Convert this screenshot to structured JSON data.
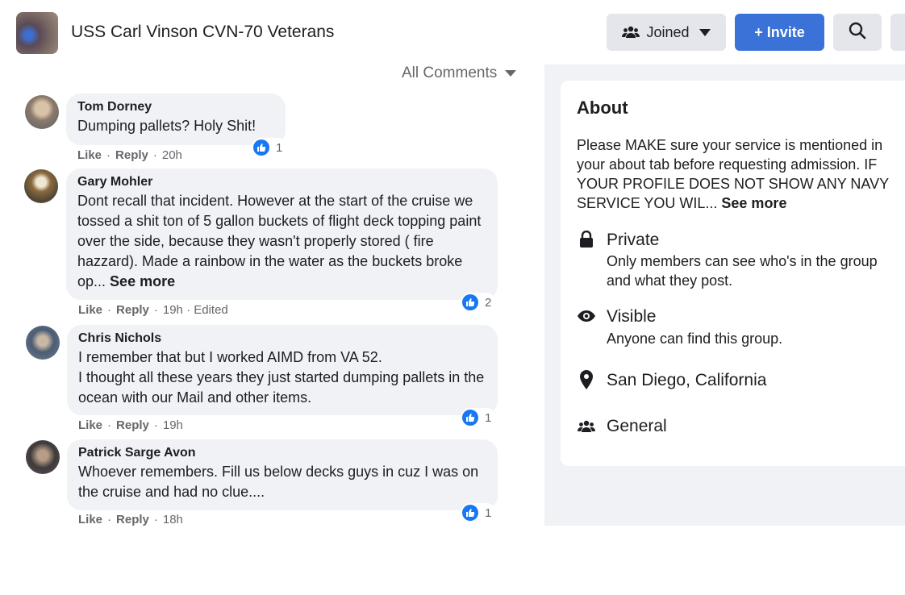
{
  "header": {
    "group_name": "USS Carl Vinson CVN-70 Veterans",
    "joined_label": "Joined",
    "invite_label": "+ Invite",
    "icons": [
      "group-avatar",
      "people-icon",
      "chevron-down-icon",
      "search-icon",
      "more-icon"
    ]
  },
  "comments_sort": "All Comments",
  "comments": [
    {
      "author": "Tom Dorney",
      "text": "Dumping pallets? Holy Shit!",
      "like": "Like",
      "reply": "Reply",
      "meta": "20h",
      "reactions": "1"
    },
    {
      "author": "Gary Mohler",
      "text": "Dont recall that incident. However at the start of the cruise we tossed a shit ton of 5 gallon buckets of flight deck topping paint over the side, because they wasn't properly stored ( fire hazzard). Made a rainbow in the water as the buckets broke op...",
      "see_more": "See more",
      "like": "Like",
      "reply": "Reply",
      "meta": "19h · Edited",
      "reactions": "2"
    },
    {
      "author": "Chris Nichols",
      "text_line1": "I remember that but I worked AIMD from VA 52.",
      "text_line2": "I thought all these years they just started dumping pallets in the ocean with our Mail and other items.",
      "like": "Like",
      "reply": "Reply",
      "meta": "19h",
      "reactions": "1"
    },
    {
      "author": "Patrick Sarge Avon",
      "text": "Whoever remembers. Fill us below decks guys in cuz I was on the cruise and had no clue....",
      "like": "Like",
      "reply": "Reply",
      "meta": "18h",
      "reactions": "1"
    }
  ],
  "about": {
    "title": "About",
    "desc_lines": [
      "Please MAKE sure your service is mentioned in",
      "your about tab before requesting admission. IF",
      "YOUR PROFILE DOES NOT SHOW ANY NAVY",
      "SERVICE YOU WIL..."
    ],
    "see_more": "See more",
    "private_title": "Private",
    "private_sub_lines": [
      "Only members can see who's in the group",
      "and what they post."
    ],
    "visible_title": "Visible",
    "visible_sub": "Anyone can find this group.",
    "location": "San Diego, California",
    "category": "General"
  },
  "colors": {
    "accent": "#3a72d8",
    "like_blue": "#1877f2",
    "bubble": "#f0f2f5",
    "muted_text": "#65676b"
  }
}
